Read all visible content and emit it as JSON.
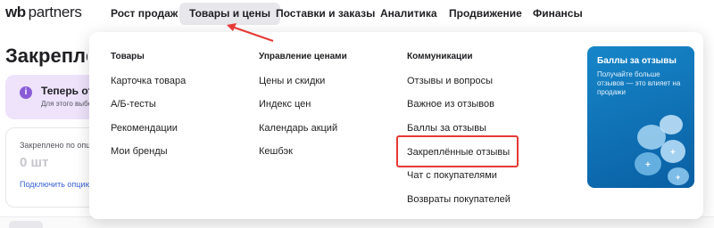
{
  "brand": {
    "wb": "wb",
    "partners": "partners"
  },
  "nav": {
    "items": [
      {
        "label": "Рост продаж"
      },
      {
        "label": "Товары и цены"
      },
      {
        "label": "Поставки и заказы"
      },
      {
        "label": "Аналитика"
      },
      {
        "label": "Продвижение"
      },
      {
        "label": "Финансы"
      }
    ]
  },
  "page": {
    "title": "Закреплённые отзывы",
    "promo": {
      "icon": "i",
      "title": "Теперь отзывы",
      "text": "Для этого выберите"
    },
    "stat": {
      "label": "Закреплено по опции",
      "value": "0 шт",
      "link": "Подключить опцию"
    }
  },
  "dropdown": {
    "columns": [
      {
        "title": "Товары",
        "items": [
          "Карточка товара",
          "А/Б-тесты",
          "Рекомендации",
          "Мои бренды"
        ]
      },
      {
        "title": "Управление ценами",
        "items": [
          "Цены и скидки",
          "Индекс цен",
          "Календарь акций",
          "Кешбэк"
        ]
      },
      {
        "title": "Коммуникации",
        "items": [
          "Отзывы и вопросы",
          "Важное из отзывов",
          "Баллы за отзывы",
          "Закреплённые отзывы",
          "Чат с покупателями",
          "Возвраты покупателей"
        ]
      }
    ],
    "ad": {
      "title": "Баллы за отзывы",
      "text": "Получайте больше отзывов — это влияет на продажи"
    }
  },
  "colors": {
    "annotation": "#e53935",
    "ad_background": "#1686c9",
    "active_nav": "#e7e7ec"
  }
}
